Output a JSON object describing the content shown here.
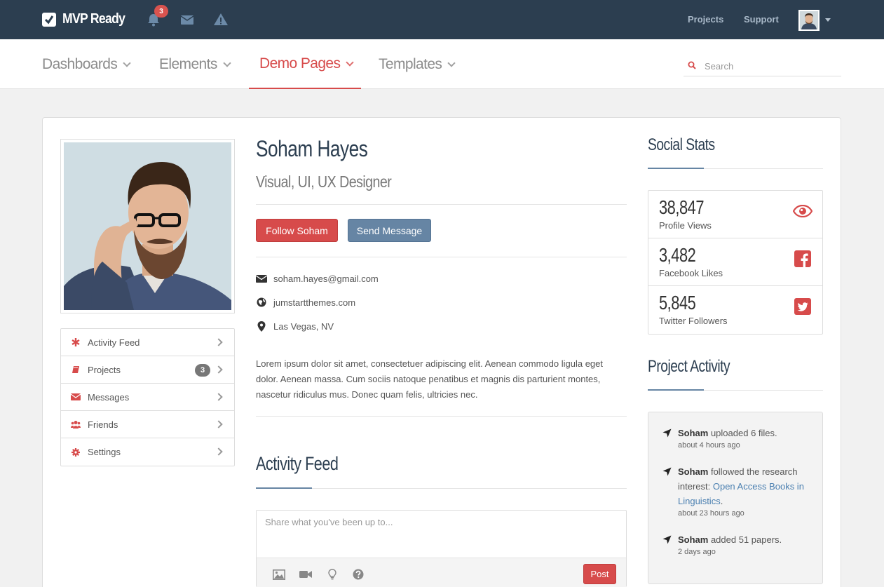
{
  "topbar": {
    "brand": "MVP Ready",
    "notification_count": "3",
    "links": [
      "Projects",
      "Support"
    ]
  },
  "nav": {
    "items": [
      {
        "label": "Dashboards"
      },
      {
        "label": "Elements"
      },
      {
        "label": "Demo Pages"
      },
      {
        "label": "Templates"
      }
    ],
    "active": "Demo Pages",
    "search_placeholder": "Search"
  },
  "profile": {
    "name": "Soham Hayes",
    "role": "Visual, UI, UX Designer",
    "follow_label": "Follow Soham",
    "message_label": "Send Message",
    "email": "soham.hayes@gmail.com",
    "website": "jumstartthemes.com",
    "location": "Las Vegas, NV",
    "bio": "Lorem ipsum dolor sit amet, consectetuer adipiscing elit. Aenean commodo ligula eget dolor. Aenean massa. Cum sociis natoque penatibus et magnis dis parturient montes, nascetur ridiculus mus. Donec quam felis, ultricies nec."
  },
  "sidebar": {
    "items": [
      {
        "label": "Activity Feed",
        "icon": "asterisk-icon"
      },
      {
        "label": "Projects",
        "icon": "book-icon",
        "badge": "3"
      },
      {
        "label": "Messages",
        "icon": "envelope-icon"
      },
      {
        "label": "Friends",
        "icon": "group-icon"
      },
      {
        "label": "Settings",
        "icon": "gear-icon"
      }
    ]
  },
  "feed": {
    "title": "Activity Feed",
    "placeholder": "Share what you've been up to...",
    "post_label": "Post"
  },
  "social_stats": {
    "title": "Social Stats",
    "items": [
      {
        "value": "38,847",
        "label": "Profile Views",
        "icon": "eye-icon"
      },
      {
        "value": "3,482",
        "label": "Facebook Likes",
        "icon": "facebook-icon"
      },
      {
        "value": "5,845",
        "label": "Twitter Followers",
        "icon": "twitter-icon"
      }
    ]
  },
  "project_activity": {
    "title": "Project Activity",
    "items": [
      {
        "user": "Soham",
        "text": " uploaded 6 files.",
        "time": "about 4 hours ago"
      },
      {
        "user": "Soham",
        "text": " followed the research interest: ",
        "link": "Open Access Books in Linguistics",
        "after": ".",
        "time": "about 23 hours ago"
      },
      {
        "user": "Soham",
        "text": " added 51 papers.",
        "time": "2 days ago"
      }
    ]
  },
  "colors": {
    "topbar": "#2c3e50",
    "accent_red": "#d74b4b",
    "accent_blue": "#6685a4"
  }
}
